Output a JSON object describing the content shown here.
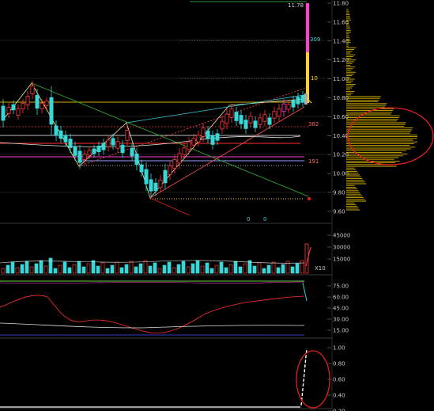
{
  "main_panel": {
    "price_ticks": [
      "11.80",
      "11.60",
      "11.40",
      "11.20",
      "11.00",
      "10.80",
      "10.60",
      "10.40",
      "10.20",
      "10.00",
      "9.80",
      "9.60"
    ],
    "level_labels": [
      "11.78",
      "309",
      "10",
      "382",
      "191"
    ],
    "marker_labels": [
      "0",
      "0"
    ]
  },
  "volume_panel": {
    "ticks": [
      "45000",
      "30000",
      "15000"
    ],
    "unit_label": "X10"
  },
  "oscillator_panel": {
    "ticks": [
      "75.00",
      "60.00",
      "45.00",
      "30.00",
      "15.00"
    ]
  },
  "bottom_panel": {
    "ticks": [
      "1.00",
      "0.80",
      "0.60",
      "0.40",
      "0.20"
    ]
  },
  "colors": {
    "up_candle": "#ff3a3a",
    "down_candle": "#39d7d7",
    "highlight": "#ff3fd0",
    "fib_yellow": "#ffd21f",
    "annotation_circle": "#e02020"
  }
}
